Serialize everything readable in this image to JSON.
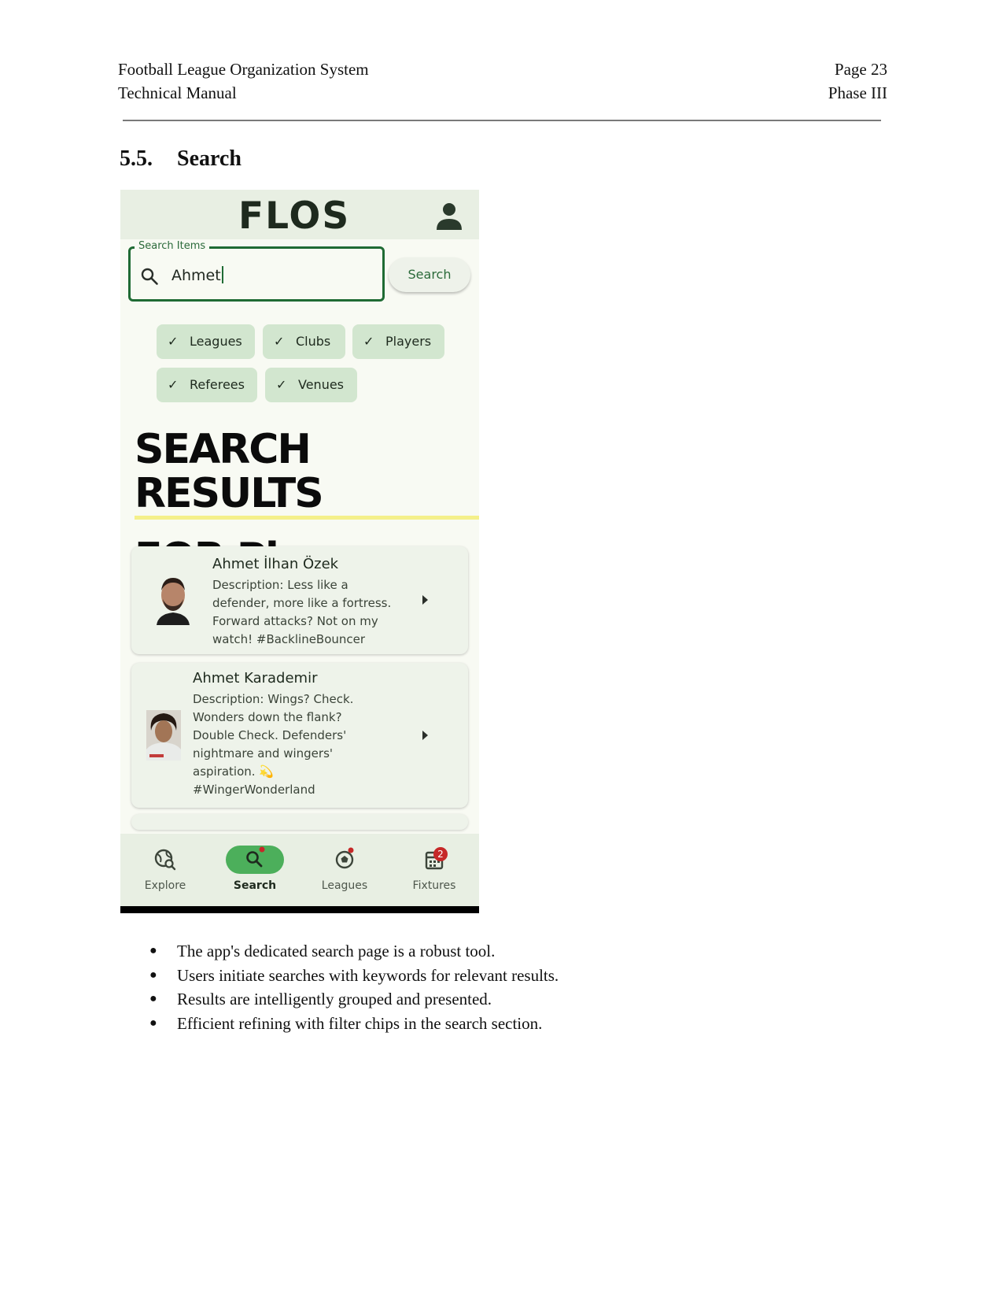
{
  "header": {
    "doc_title": "Football League Organization System",
    "doc_subtitle": "Technical Manual",
    "page": "Page 23",
    "phase": "Phase III"
  },
  "section": {
    "number": "5.5.",
    "title": "Search"
  },
  "app": {
    "logo": "FLOS",
    "search": {
      "label": "Search Items",
      "value": "Ahmet",
      "button_label": "Search"
    },
    "filter_chips": [
      {
        "label": "Leagues",
        "selected": true
      },
      {
        "label": "Clubs",
        "selected": true
      },
      {
        "label": "Players",
        "selected": true
      },
      {
        "label": "Referees",
        "selected": true
      },
      {
        "label": "Venues",
        "selected": true
      }
    ],
    "results_heading": {
      "line1": "SEARCH RESULTS",
      "line2": "FOR Players"
    },
    "results": [
      {
        "name": "Ahmet İlhan Özek",
        "description_lines": [
          "Description: Less like a",
          "defender, more like a fortress.",
          "Forward attacks? Not on my",
          "watch! #BacklineBouncer"
        ]
      },
      {
        "name": "Ahmet Karademir",
        "description_lines": [
          "Description: Wings? Check.",
          "Wonders down the flank?",
          "Double Check. Defenders'",
          "nightmare and wingers'",
          "aspiration. 💫",
          "#WingerWonderland"
        ]
      }
    ],
    "bottom_nav": [
      {
        "label": "Explore",
        "icon": "explore-icon"
      },
      {
        "label": "Search",
        "icon": "search-icon",
        "active": true
      },
      {
        "label": "Leagues",
        "icon": "soccer-ball-icon"
      },
      {
        "label": "Fixtures",
        "icon": "calendar-icon",
        "badge": "2"
      }
    ],
    "colors": {
      "accent": "#1f6b34",
      "active_pill": "#4caf5b",
      "chip": "#d2e6cf",
      "badge": "#c62828"
    }
  },
  "bullets": [
    "The app's dedicated search page is a robust tool.",
    "Users initiate searches with keywords for relevant results.",
    "Results are intelligently grouped and presented.",
    "Efficient refining with filter chips in the search section."
  ],
  "bullet_glyph": "●"
}
